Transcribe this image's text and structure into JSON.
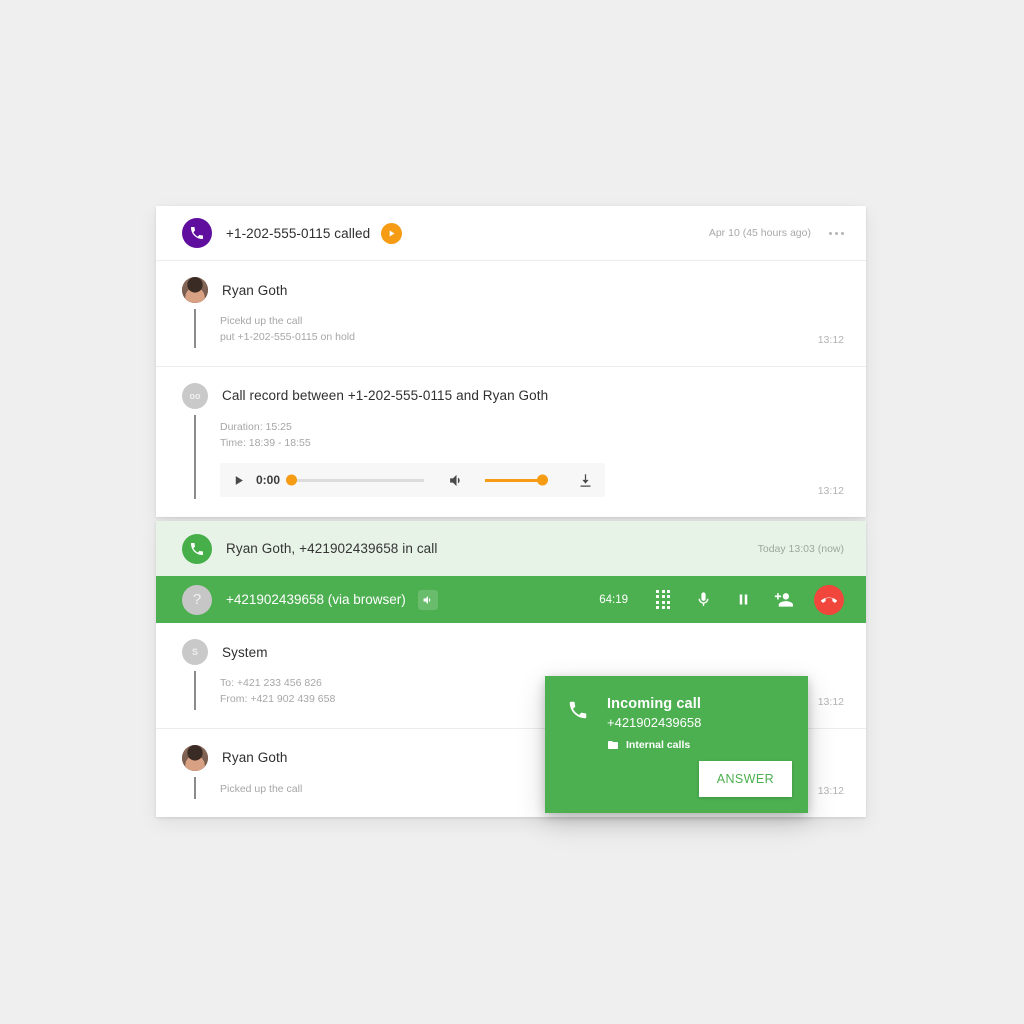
{
  "history_card": {
    "header": {
      "icon": "phone-icon",
      "title": "+1-202-555-0115 called",
      "play_badge_icon": "play-icon",
      "timestamp": "Apr 10 (45 hours ago)",
      "menu_icon": "more-options-icon"
    },
    "messages": [
      {
        "avatar_type": "photo",
        "avatar_label": "",
        "name": "Ryan Goth",
        "lines": [
          "Picekd up the call",
          "put +1-202-555-0115 on hold"
        ],
        "time": "13:12"
      },
      {
        "avatar_type": "initials",
        "avatar_label": "oo",
        "name": "Call record between +1-202-555-0115 and Ryan Goth",
        "lines": [
          "Duration: 15:25",
          "Time: 18:39 - 18:55"
        ],
        "time": "13:12"
      }
    ],
    "player": {
      "play_icon": "play-icon",
      "current_time": "0:00",
      "progress_percent": 0,
      "speaker_icon": "speaker-icon",
      "volume_percent": 100,
      "download_icon": "download-icon"
    }
  },
  "live_card": {
    "header": {
      "icon": "phone-icon",
      "title": "Ryan Goth, +421902439658 in call",
      "timestamp": "Today 13:03 (now)"
    },
    "callbar": {
      "avatar_label": "?",
      "number": "+421902439658 (via browser)",
      "speaker_icon": "speaker-icon",
      "timer": "64:19",
      "controls": [
        {
          "icon": "dialpad-icon",
          "label": "Dialpad"
        },
        {
          "icon": "microphone-icon",
          "label": "Mute"
        },
        {
          "icon": "pause-icon",
          "label": "Hold"
        },
        {
          "icon": "add-person-icon",
          "label": "Add participant"
        }
      ],
      "hangup_icon": "hangup-icon"
    },
    "messages": [
      {
        "avatar_type": "initials",
        "avatar_label": "S",
        "name": "System",
        "lines": [
          "To: +421 233 456 826",
          "From: +421 902 439 658"
        ],
        "time": "13:12"
      },
      {
        "avatar_type": "photo",
        "avatar_label": "",
        "name": "Ryan Goth",
        "lines": [
          "Picked up the call"
        ],
        "time": "13:12"
      }
    ]
  },
  "popup": {
    "icon": "phone-icon",
    "title": "Incoming call",
    "number": "+421902439658",
    "folder_icon": "folder-icon",
    "folder_label": "Internal calls",
    "answer_label": "ANSWER"
  },
  "colors": {
    "purple": "#5f0e9e",
    "green": "#4caf50",
    "green_tint": "#e8f3e8",
    "orange": "#f59b14",
    "red": "#f0463c",
    "background": "#efefef"
  }
}
